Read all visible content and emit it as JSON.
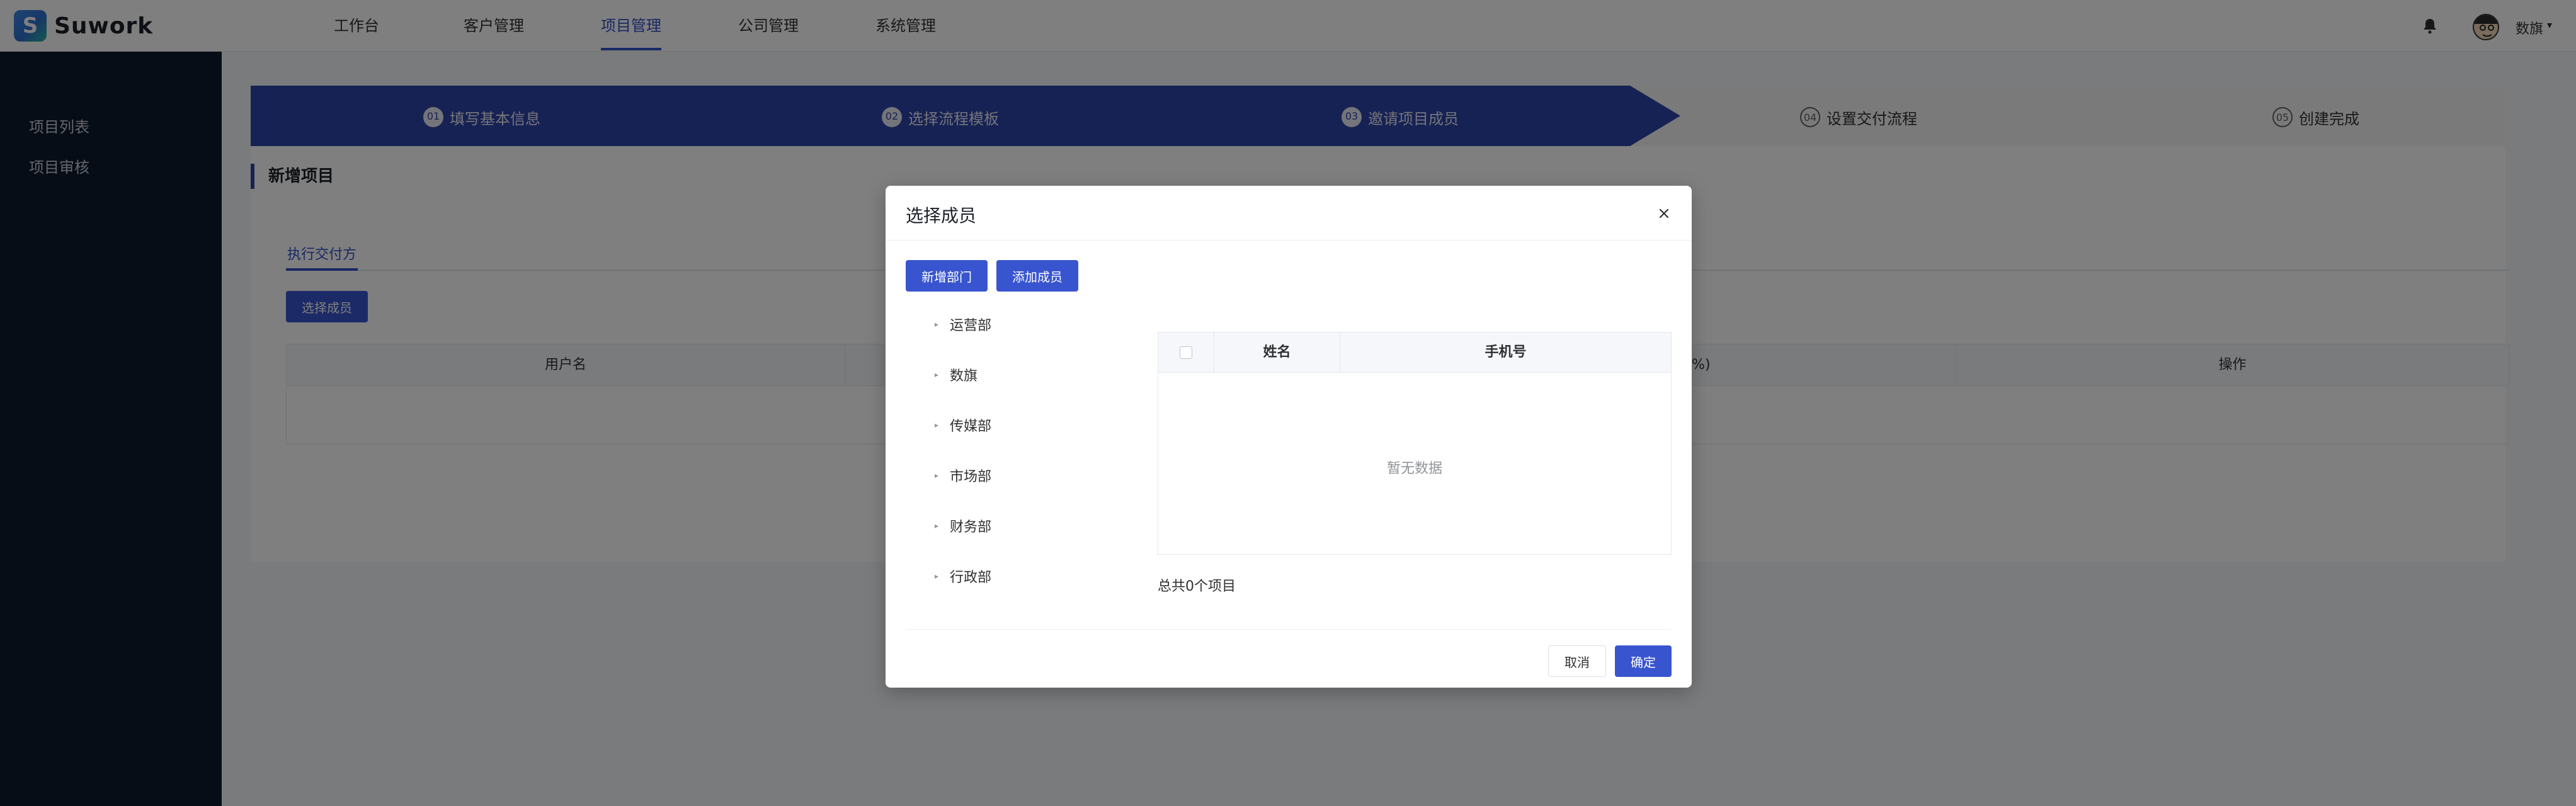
{
  "app": {
    "logo_text": "Suwork",
    "logo_glyph": "S"
  },
  "topnav": {
    "items": [
      {
        "label": "工作台"
      },
      {
        "label": "客户管理"
      },
      {
        "label": "项目管理",
        "active": true
      },
      {
        "label": "公司管理"
      },
      {
        "label": "系统管理"
      }
    ]
  },
  "user": {
    "name": "数旗",
    "caret": "▾"
  },
  "sidebar": {
    "items": [
      {
        "label": "项目列表"
      },
      {
        "label": "项目审核"
      }
    ]
  },
  "steps": [
    {
      "num": "01",
      "label": "填写基本信息",
      "state": "done"
    },
    {
      "num": "02",
      "label": "选择流程模板",
      "state": "done"
    },
    {
      "num": "03",
      "label": "邀请项目成员",
      "state": "done"
    },
    {
      "num": "04",
      "label": "设置交付流程",
      "state": "todo"
    },
    {
      "num": "05",
      "label": "创建完成",
      "state": "todo"
    }
  ],
  "page": {
    "section_title": "新增项目",
    "tab": "执行交付方",
    "select_button": "选择成员",
    "table_headers": [
      "用户名",
      "",
      "占比例(%)",
      "操作"
    ]
  },
  "dialog": {
    "title": "选择成员",
    "add_dept_button": "新增部门",
    "add_member_button": "添加成员",
    "tree": [
      "运营部",
      "数旗",
      "传媒部",
      "市场部",
      "财务部",
      "行政部"
    ],
    "tree_caret": "▸",
    "table_headers": {
      "name": "姓名",
      "phone": "手机号"
    },
    "empty_text": "暂无数据",
    "total_text": "总共0个项目",
    "cancel_button": "取消",
    "confirm_button": "确定"
  },
  "colors": {
    "primary": "#3855cf",
    "step_fill": "#2f45a8",
    "sidebar_bg": "#0f1a2e"
  }
}
